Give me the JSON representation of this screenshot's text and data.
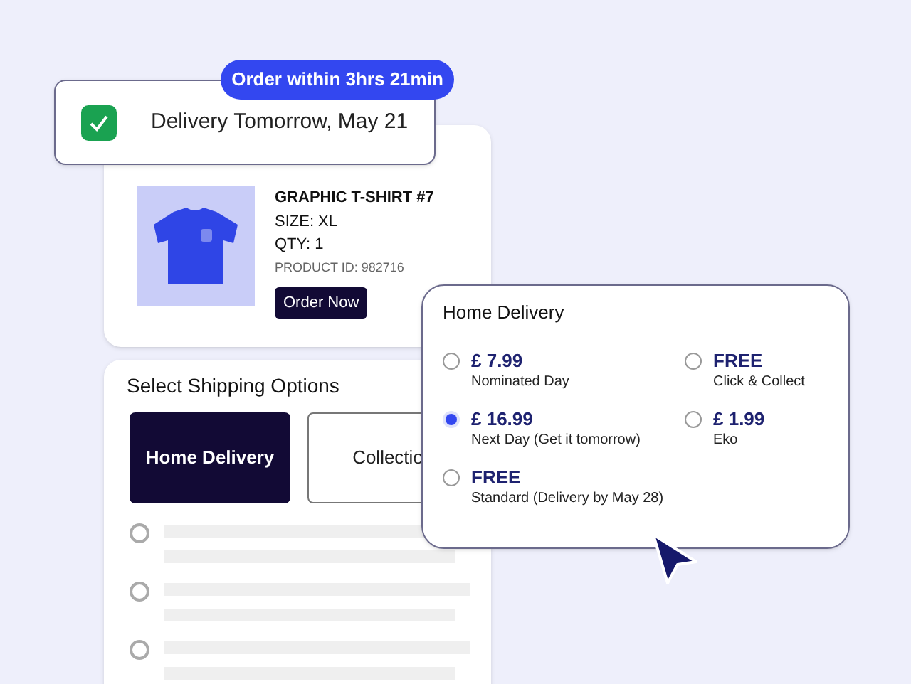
{
  "deadline_badge": "Order within 3hrs 21min",
  "delivery_banner": {
    "checked": true,
    "text": "Delivery Tomorrow, May 21"
  },
  "product": {
    "name": "GRAPHIC T-SHIRT #7",
    "size": "SIZE: XL",
    "qty": "QTY: 1",
    "product_id": "PRODUCT ID: 982716",
    "button": "Order Now"
  },
  "shipping": {
    "title": "Select Shipping Options",
    "tabs": [
      {
        "label": "Home Delivery",
        "selected": true
      },
      {
        "label": "Collectio",
        "selected": false
      }
    ],
    "placeholder_rows": [
      {
        "selected": false
      },
      {
        "selected": false
      },
      {
        "selected": false
      }
    ]
  },
  "popup": {
    "title": "Home Delivery",
    "options": [
      {
        "price": "£ 7.99",
        "description": "Nominated Day",
        "selected": false
      },
      {
        "price": "FREE",
        "description": "Click & Collect",
        "selected": false
      },
      {
        "price": "£ 16.99",
        "description": "Next Day (Get it tomorrow)",
        "selected": true
      },
      {
        "price": "£ 1.99",
        "description": "Eko",
        "selected": false
      },
      {
        "price": "FREE",
        "description": "Standard (Delivery by May 28)",
        "selected": false
      }
    ]
  }
}
